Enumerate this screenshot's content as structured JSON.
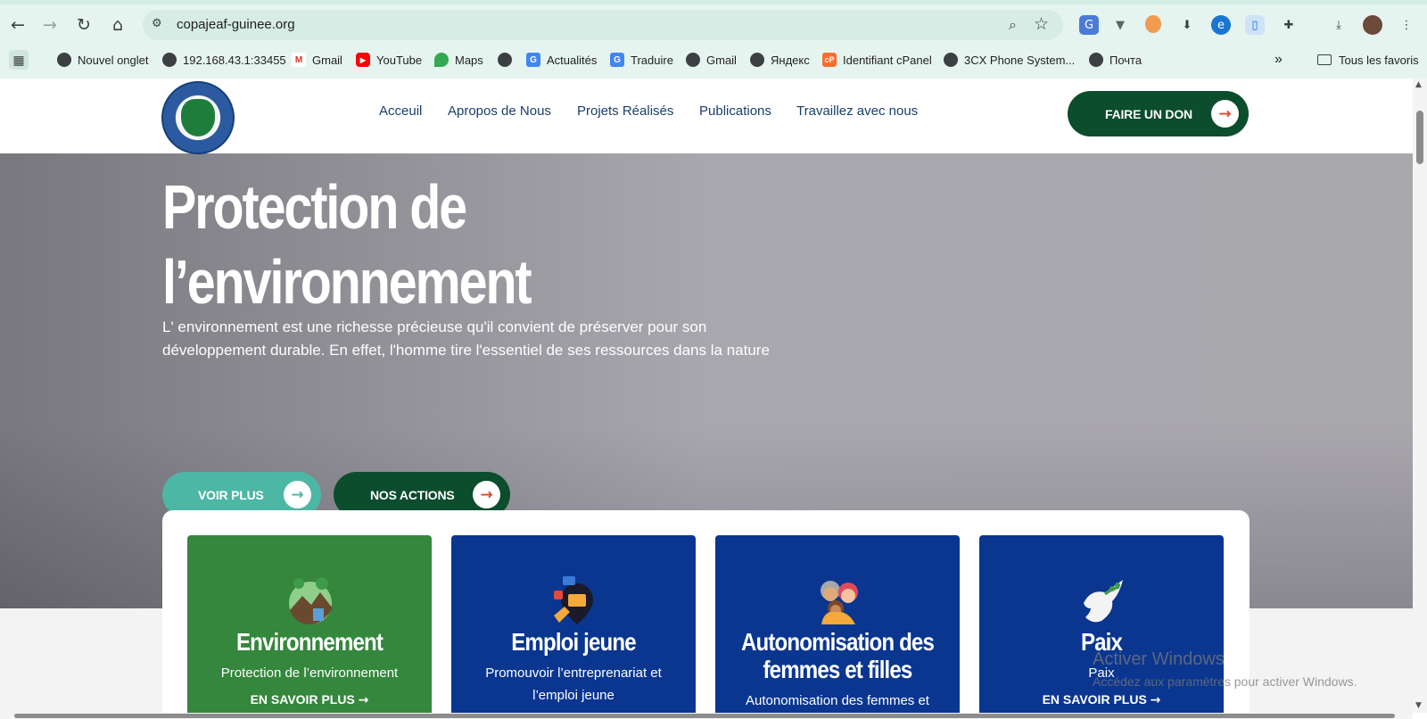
{
  "browser": {
    "url": "copajeaf-guinee.org",
    "bookmarks": [
      {
        "label": "Nouvel onglet",
        "icon": "globe-icon"
      },
      {
        "label": "192.168.43.1:33455",
        "icon": "globe-icon"
      },
      {
        "label": "Gmail",
        "icon": "gmail-icon"
      },
      {
        "label": "YouTube",
        "icon": "youtube-icon"
      },
      {
        "label": "Maps",
        "icon": "maps-icon"
      },
      {
        "label": "",
        "icon": "globe-icon"
      },
      {
        "label": "Actualités",
        "icon": "news-icon"
      },
      {
        "label": "Traduire",
        "icon": "translate-icon"
      },
      {
        "label": "Gmail",
        "icon": "globe-icon"
      },
      {
        "label": "Яндекс",
        "icon": "globe-icon"
      },
      {
        "label": "Identifiant cPanel",
        "icon": "cpanel-icon"
      },
      {
        "label": "3CX Phone System...",
        "icon": "globe-icon"
      },
      {
        "label": "Почта",
        "icon": "globe-icon"
      }
    ],
    "overflow_label": "»",
    "all_bookmarks_label": "Tous les favoris"
  },
  "site": {
    "menu": [
      "Acceuil",
      "Apropos de Nous",
      "Projets Réalisés",
      "Publications",
      "Travaillez avec nous"
    ],
    "donate_label": "FAIRE UN DON",
    "hero": {
      "title_line1": "Protection de",
      "title_line2": "l’environnement",
      "text": "L' environnement est une richesse précieuse qu'il convient de préserver pour son développement durable. En effet, l'homme tire l'essentiel de ses ressources dans la nature",
      "btn_more": "VOIR PLUS",
      "btn_actions": "NOS ACTIONS"
    },
    "cards": [
      {
        "title": "Environnement",
        "desc": "Protection de l’environnement",
        "more": "EN SAVOIR PLUS",
        "color": "#34873c",
        "icon": "landscape-icon"
      },
      {
        "title": "Emploi jeune",
        "desc": "Promouvoir l’entreprenariat et l’emploi jeune",
        "more": "",
        "color": "#0a3690",
        "icon": "job-location-icon"
      },
      {
        "title": "Autonomisation des femmes et filles",
        "desc": "Autonomisation des femmes et",
        "more": "",
        "color": "#0a3690",
        "icon": "people-icon"
      },
      {
        "title": "Paix",
        "desc": "Paix",
        "more": "EN SAVOIR PLUS",
        "color": "#0a3690",
        "icon": "dove-icon"
      }
    ]
  },
  "watermark": {
    "title": "Activer Windows",
    "subtitle": "Accédez aux paramètres pour activer Windows."
  },
  "colors": {
    "accent_green": "#0b4d2c",
    "teal_button": "#4cb7a4",
    "arrow_red": "#e0442c"
  }
}
